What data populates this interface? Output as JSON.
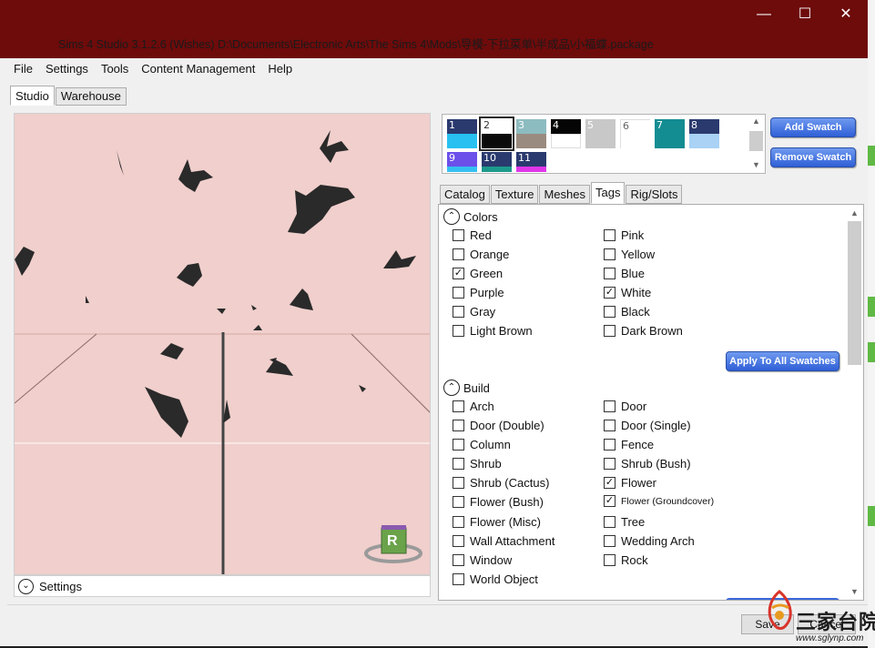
{
  "window": {
    "title": "Sims 4 Studio 3.1.2.6 (Wishes)  D:\\Documents\\Electronic Arts\\The Sims 4\\Mods\\导模-下拉菜单\\半成品\\小福蝶.package",
    "minimize": "—",
    "maximize": "☐",
    "close": "✕"
  },
  "menu": [
    "File",
    "Settings",
    "Tools",
    "Content Management",
    "Help"
  ],
  "main_tabs": [
    "Studio",
    "Warehouse"
  ],
  "viewport": {
    "settings_label": "Settings",
    "cube_letter": "R"
  },
  "swatches": [
    {
      "num": "1",
      "top": "#2a3a6e",
      "bottom": "#27c0f0"
    },
    {
      "num": "2",
      "top": "#ffffff",
      "bottom": "#0a0a0a",
      "selected": true
    },
    {
      "num": "3",
      "top": "#8dbcc0",
      "bottom": "#9a8b80"
    },
    {
      "num": "4",
      "top": "#050505",
      "bottom": "#ffffff"
    },
    {
      "num": "5",
      "top": "#c8c8c8",
      "bottom": "#c8c8c8"
    },
    {
      "num": "6",
      "top": "#ffffff",
      "bottom": "#ffffff"
    },
    {
      "num": "7",
      "top": "#138c92",
      "bottom": "#138c92"
    },
    {
      "num": "8",
      "top": "#2a3a6e",
      "bottom": "#a9d2f5"
    },
    {
      "num": "9",
      "top": "#6b50ea",
      "bottom": "#34c0f0"
    },
    {
      "num": "10",
      "top": "#2a3a6e",
      "bottom": "#1c9a8c"
    },
    {
      "num": "11",
      "top": "#2a3a6e",
      "bottom": "#e035e8"
    }
  ],
  "swatch_buttons": {
    "add": "Add Swatch",
    "remove": "Remove Swatch"
  },
  "right_tabs": [
    "Catalog",
    "Texture",
    "Meshes",
    "Tags",
    "Rig/Slots"
  ],
  "colors_section": {
    "title": "Colors",
    "left": [
      {
        "label": "Red",
        "checked": false
      },
      {
        "label": "Orange",
        "checked": false
      },
      {
        "label": "Green",
        "checked": true
      },
      {
        "label": "Purple",
        "checked": false
      },
      {
        "label": "Gray",
        "checked": false
      },
      {
        "label": "Light Brown",
        "checked": false
      }
    ],
    "right": [
      {
        "label": "Pink",
        "checked": false
      },
      {
        "label": "Yellow",
        "checked": false
      },
      {
        "label": "Blue",
        "checked": false
      },
      {
        "label": "White",
        "checked": true
      },
      {
        "label": "Black",
        "checked": false
      },
      {
        "label": "Dark Brown",
        "checked": false
      }
    ],
    "apply_button": "Apply To All Swatches"
  },
  "build_section": {
    "title": "Build",
    "left": [
      {
        "label": "Arch",
        "checked": false
      },
      {
        "label": "Door (Double)",
        "checked": false
      },
      {
        "label": "Column",
        "checked": false
      },
      {
        "label": "Shrub",
        "checked": false
      },
      {
        "label": "Shrub (Cactus)",
        "checked": false
      },
      {
        "label": "Flower (Bush)",
        "checked": false
      },
      {
        "label": "Flower (Misc)",
        "checked": false
      },
      {
        "label": "Wall Attachment",
        "checked": false
      },
      {
        "label": "Window",
        "checked": false
      },
      {
        "label": "World Object",
        "checked": false
      }
    ],
    "right": [
      {
        "label": "Door",
        "checked": false
      },
      {
        "label": "Door (Single)",
        "checked": false
      },
      {
        "label": "Fence",
        "checked": false
      },
      {
        "label": "Shrub (Bush)",
        "checked": false
      },
      {
        "label": "Flower",
        "checked": true
      },
      {
        "label": "Flower (Groundcover)",
        "checked": true,
        "small": true
      },
      {
        "label": "Tree",
        "checked": false
      },
      {
        "label": "Wedding Arch",
        "checked": false
      },
      {
        "label": "Rock",
        "checked": false
      }
    ]
  },
  "footer": {
    "save": "Save",
    "cancel": "Cancel"
  },
  "watermark": {
    "name": "三家台院",
    "url": "www.sglynp.com"
  },
  "colors": {
    "titlebar": "#6e0b0b",
    "viewport_bg": "#f0cfcc",
    "button_blue": "#3a68dc"
  }
}
